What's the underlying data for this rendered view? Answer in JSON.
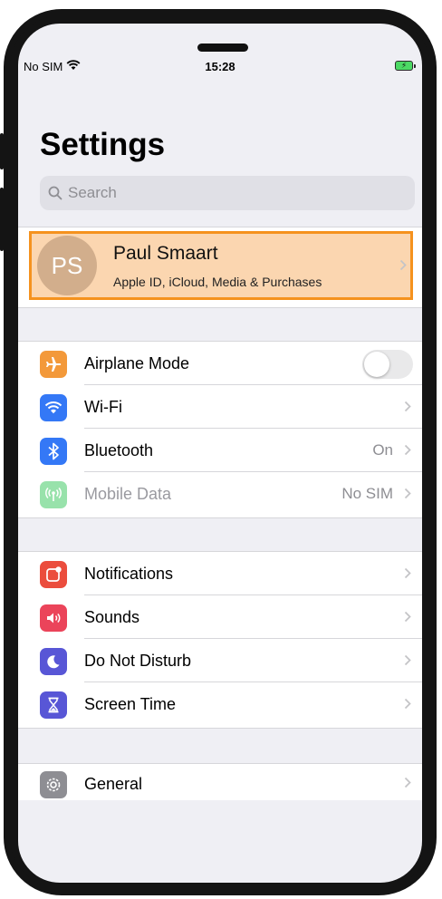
{
  "status_bar": {
    "carrier": "No SIM",
    "time": "15:28",
    "wifi_icon": "wifi-icon",
    "battery_icon": "battery-charging-icon"
  },
  "header": {
    "title": "Settings"
  },
  "search": {
    "placeholder": "Search",
    "icon": "search-icon"
  },
  "profile": {
    "initials": "PS",
    "name": "Paul Smaart",
    "subtitle": "Apple ID, iCloud, Media & Purchases",
    "highlight_color": "#f5921e"
  },
  "groups": [
    {
      "rows": [
        {
          "label": "Airplane Mode",
          "icon": "airplane-icon",
          "color": "#f3993a",
          "control": "toggle",
          "toggle_on": false
        },
        {
          "label": "Wi-Fi",
          "icon": "wifi-icon",
          "color": "#3478f6",
          "control": "chevron"
        },
        {
          "label": "Bluetooth",
          "icon": "bluetooth-icon",
          "color": "#3478f6",
          "value": "On",
          "control": "chevron"
        },
        {
          "label": "Mobile Data",
          "icon": "antenna-icon",
          "color": "#34c759",
          "value": "No SIM",
          "control": "chevron",
          "disabled": true
        }
      ]
    },
    {
      "rows": [
        {
          "label": "Notifications",
          "icon": "notifications-icon",
          "color": "#eb4d3d",
          "control": "chevron"
        },
        {
          "label": "Sounds",
          "icon": "speaker-icon",
          "color": "#eb445a",
          "control": "chevron"
        },
        {
          "label": "Do Not Disturb",
          "icon": "moon-icon",
          "color": "#5856d6",
          "control": "chevron"
        },
        {
          "label": "Screen Time",
          "icon": "hourglass-icon",
          "color": "#5856d6",
          "control": "chevron"
        }
      ]
    },
    {
      "rows": [
        {
          "label": "General",
          "icon": "gear-icon",
          "color": "#8e8e93",
          "control": "chevron"
        }
      ]
    }
  ]
}
